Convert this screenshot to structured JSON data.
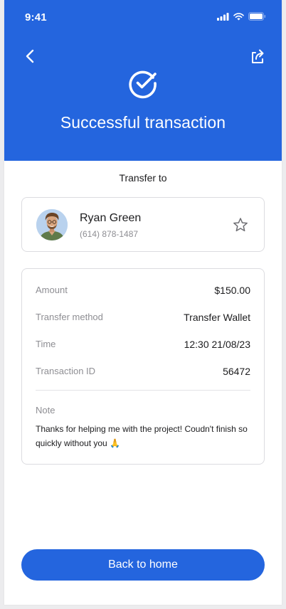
{
  "status_bar": {
    "time": "9:41"
  },
  "header": {
    "title": "Successful transaction",
    "back_icon": "chevron-left-icon",
    "share_icon": "share-icon",
    "status_icon": "check-circle-icon",
    "background_color": "#2465DE"
  },
  "recipient": {
    "section_label": "Transfer to",
    "name": "Ryan Green",
    "phone": "(614) 878-1487",
    "favorite_icon": "star-icon"
  },
  "details": {
    "rows": [
      {
        "label": "Amount",
        "value": "$150.00"
      },
      {
        "label": "Transfer method",
        "value": "Transfer Wallet"
      },
      {
        "label": "Time",
        "value": "12:30 21/08/23"
      },
      {
        "label": "Transaction ID",
        "value": "56472"
      }
    ],
    "note_label": "Note",
    "note_text": "Thanks for helping me with the project! Coudn't finish so quickly without you 🙏"
  },
  "actions": {
    "home_label": "Back to home"
  }
}
